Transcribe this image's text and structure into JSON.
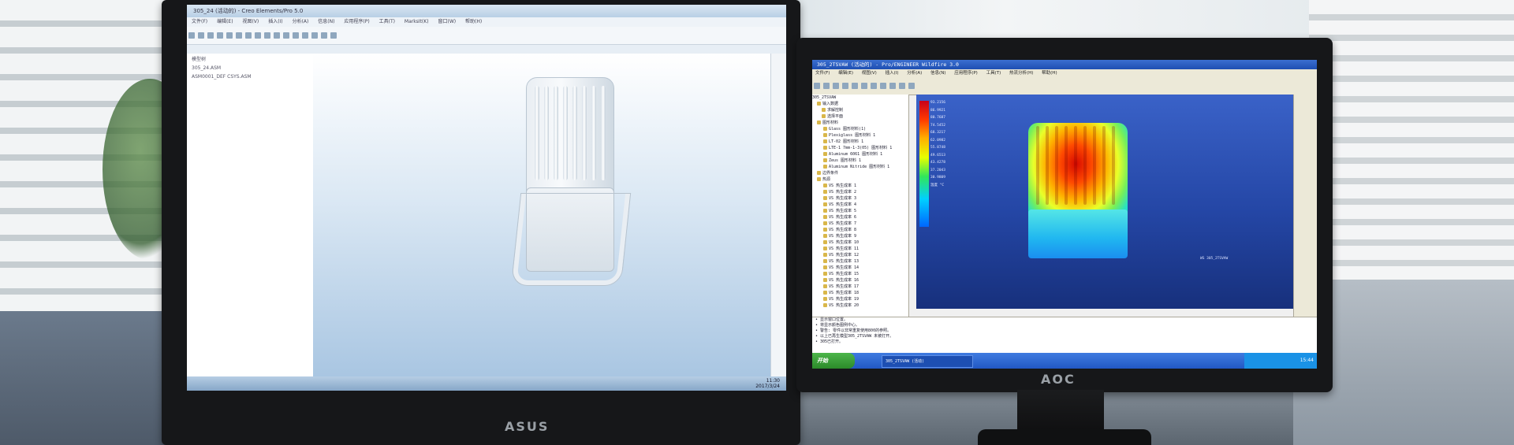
{
  "left_monitor": {
    "brand": "ASUS",
    "window_title": "305_24 (活动的) - Creo Elements/Pro 5.0",
    "menu": [
      "文件(F)",
      "编辑(E)",
      "视图(V)",
      "插入(I)",
      "分析(A)",
      "信息(N)",
      "应用程序(P)",
      "工具(T)",
      "MarksIt(K)",
      "窗口(W)",
      "帮助(H)"
    ],
    "tree_title": "模型树",
    "tree_items": [
      "305_24.ASM",
      "ASM0001_DEF CSYS.ASM"
    ],
    "clock": "11:30",
    "date": "2017/3/24"
  },
  "right_monitor": {
    "brand": "AOC",
    "window_title": "305_2TSVAW (活动的) - Pro/ENGINEER Wildfire 3.0",
    "menu": [
      "文件(F)",
      "编辑(E)",
      "视图(V)",
      "插入(I)",
      "分析(A)",
      "信息(N)",
      "应用程序(P)",
      "工具(T)",
      "热流分析(H)",
      "帮助(H)"
    ],
    "tree_items": [
      "305_2TSVAW",
      "输入数据",
      "求解控制",
      "选择平面",
      "图形材料",
      "Glass 图形材料(1)",
      "Plexiglass 图形材料 1",
      "LT-02 图形材料 1",
      "LTE-1 7mm-1-3(05) 图形材料 1",
      "Aluminum 6061 图形材料 1",
      "Zeus 图形材料 1",
      "Aluminum Nitride 图形材料 1",
      "边界条件",
      "热源",
      "VS 热生成率 1",
      "VS 热生成率 2",
      "VS 热生成率 3",
      "VS 热生成率 4",
      "VS 热生成率 5",
      "VS 热生成率 6",
      "VS 热生成率 7",
      "VS 热生成率 8",
      "VS 热生成率 9",
      "VS 热生成率 10",
      "VS 热生成率 11",
      "VS 热生成率 12",
      "VS 热生成率 13",
      "VS 热生成率 14",
      "VS 热生成率 15",
      "VS 热生成率 16",
      "VS 热生成率 17",
      "VS 热生成率 18",
      "VS 热生成率 19",
      "VS 热生成率 20"
    ],
    "legend_values": [
      "93.2156",
      "86.9921",
      "80.7687",
      "74.5452",
      "68.3217",
      "62.0982",
      "55.8748",
      "49.6513",
      "43.4278",
      "37.2043",
      "30.9809",
      "温度 °C"
    ],
    "viewport_label": "WS 305_2TSVAW",
    "messages": [
      "• 显示窗口位置。",
      "• 将显示颜色图例中心。",
      "• 警告: 零件以非常重复使用800的参照。",
      "• 以上已再生模型305_2TSVAW 未被打开。",
      "• 305已打开。"
    ],
    "start_label": "开始",
    "task_label": "305_2TSVAW (活动)",
    "clock": "15:44"
  }
}
